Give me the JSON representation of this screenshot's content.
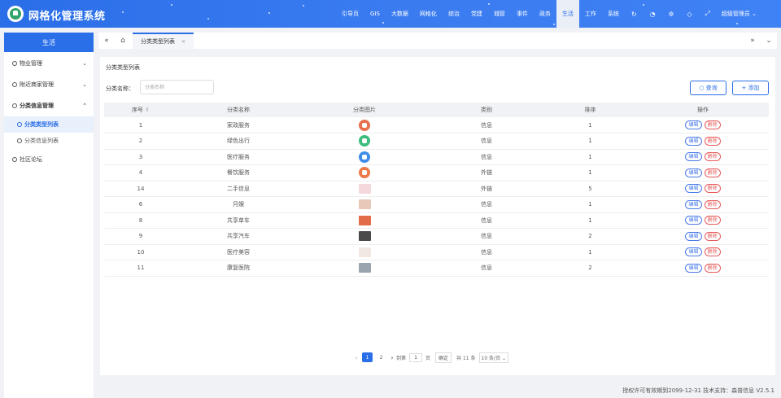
{
  "app": {
    "title": "网格化管理系统"
  },
  "nav": {
    "items": [
      "引导页",
      "GIS",
      "大数据",
      "网格化",
      "综治",
      "党建",
      "城管",
      "事件",
      "政务",
      "生活",
      "工作",
      "系统"
    ],
    "active": "生活",
    "user": "超级管理员"
  },
  "sidebar": {
    "header": "生活",
    "groups": [
      {
        "label": "物业管理"
      },
      {
        "label": "附近商家管理"
      },
      {
        "label": "分类信息管理"
      },
      {
        "label": "社区论坛"
      }
    ],
    "subitems": [
      {
        "label": "分类类型列表"
      },
      {
        "label": "分类信息列表"
      }
    ]
  },
  "tabs": {
    "current": "分类类型列表"
  },
  "panel": {
    "title": "分类类型列表",
    "search_label": "分类名称：",
    "search_placeholder": "分类名称",
    "query_label": "查询",
    "add_label": "添加"
  },
  "table": {
    "headers": [
      "序号",
      "分类名称",
      "分类图片",
      "类别",
      "排序",
      "操作"
    ],
    "edit_label": "编辑",
    "delete_label": "删除",
    "rows": [
      {
        "id": "1",
        "name": "家政服务",
        "category": "信息",
        "sort": "1",
        "icon_color": "#e8704e"
      },
      {
        "id": "2",
        "name": "绿色出行",
        "category": "信息",
        "sort": "1",
        "icon_color": "#3dbd7d"
      },
      {
        "id": "3",
        "name": "医疗服务",
        "category": "信息",
        "sort": "1",
        "icon_color": "#3f8be8"
      },
      {
        "id": "4",
        "name": "餐饮服务",
        "category": "外链",
        "sort": "1",
        "icon_color": "#ee7a4a"
      },
      {
        "id": "14",
        "name": "二手信息",
        "category": "外链",
        "sort": "5",
        "icon_color": "#f3d9dc"
      },
      {
        "id": "6",
        "name": "月嫂",
        "category": "信息",
        "sort": "1",
        "icon_color": "#e8c8b8"
      },
      {
        "id": "8",
        "name": "共享单车",
        "category": "信息",
        "sort": "1",
        "icon_color": "#e26b4a"
      },
      {
        "id": "9",
        "name": "共享汽车",
        "category": "信息",
        "sort": "2",
        "icon_color": "#4a4a4a"
      },
      {
        "id": "10",
        "name": "医疗美容",
        "category": "信息",
        "sort": "1",
        "icon_color": "#f1e8e4"
      },
      {
        "id": "11",
        "name": "康复医院",
        "category": "信息",
        "sort": "2",
        "icon_color": "#9aa4ae"
      }
    ]
  },
  "pager": {
    "page1": "1",
    "page2": "2",
    "goto_label": "到第",
    "goto_value": "1",
    "page_unit": "页",
    "confirm": "确定",
    "total": "共 11 条",
    "page_size": "10 条/页"
  },
  "footer": {
    "text": "授权许可有效期到2099-12-31  技术支持：森普信息  V2.5.1"
  }
}
